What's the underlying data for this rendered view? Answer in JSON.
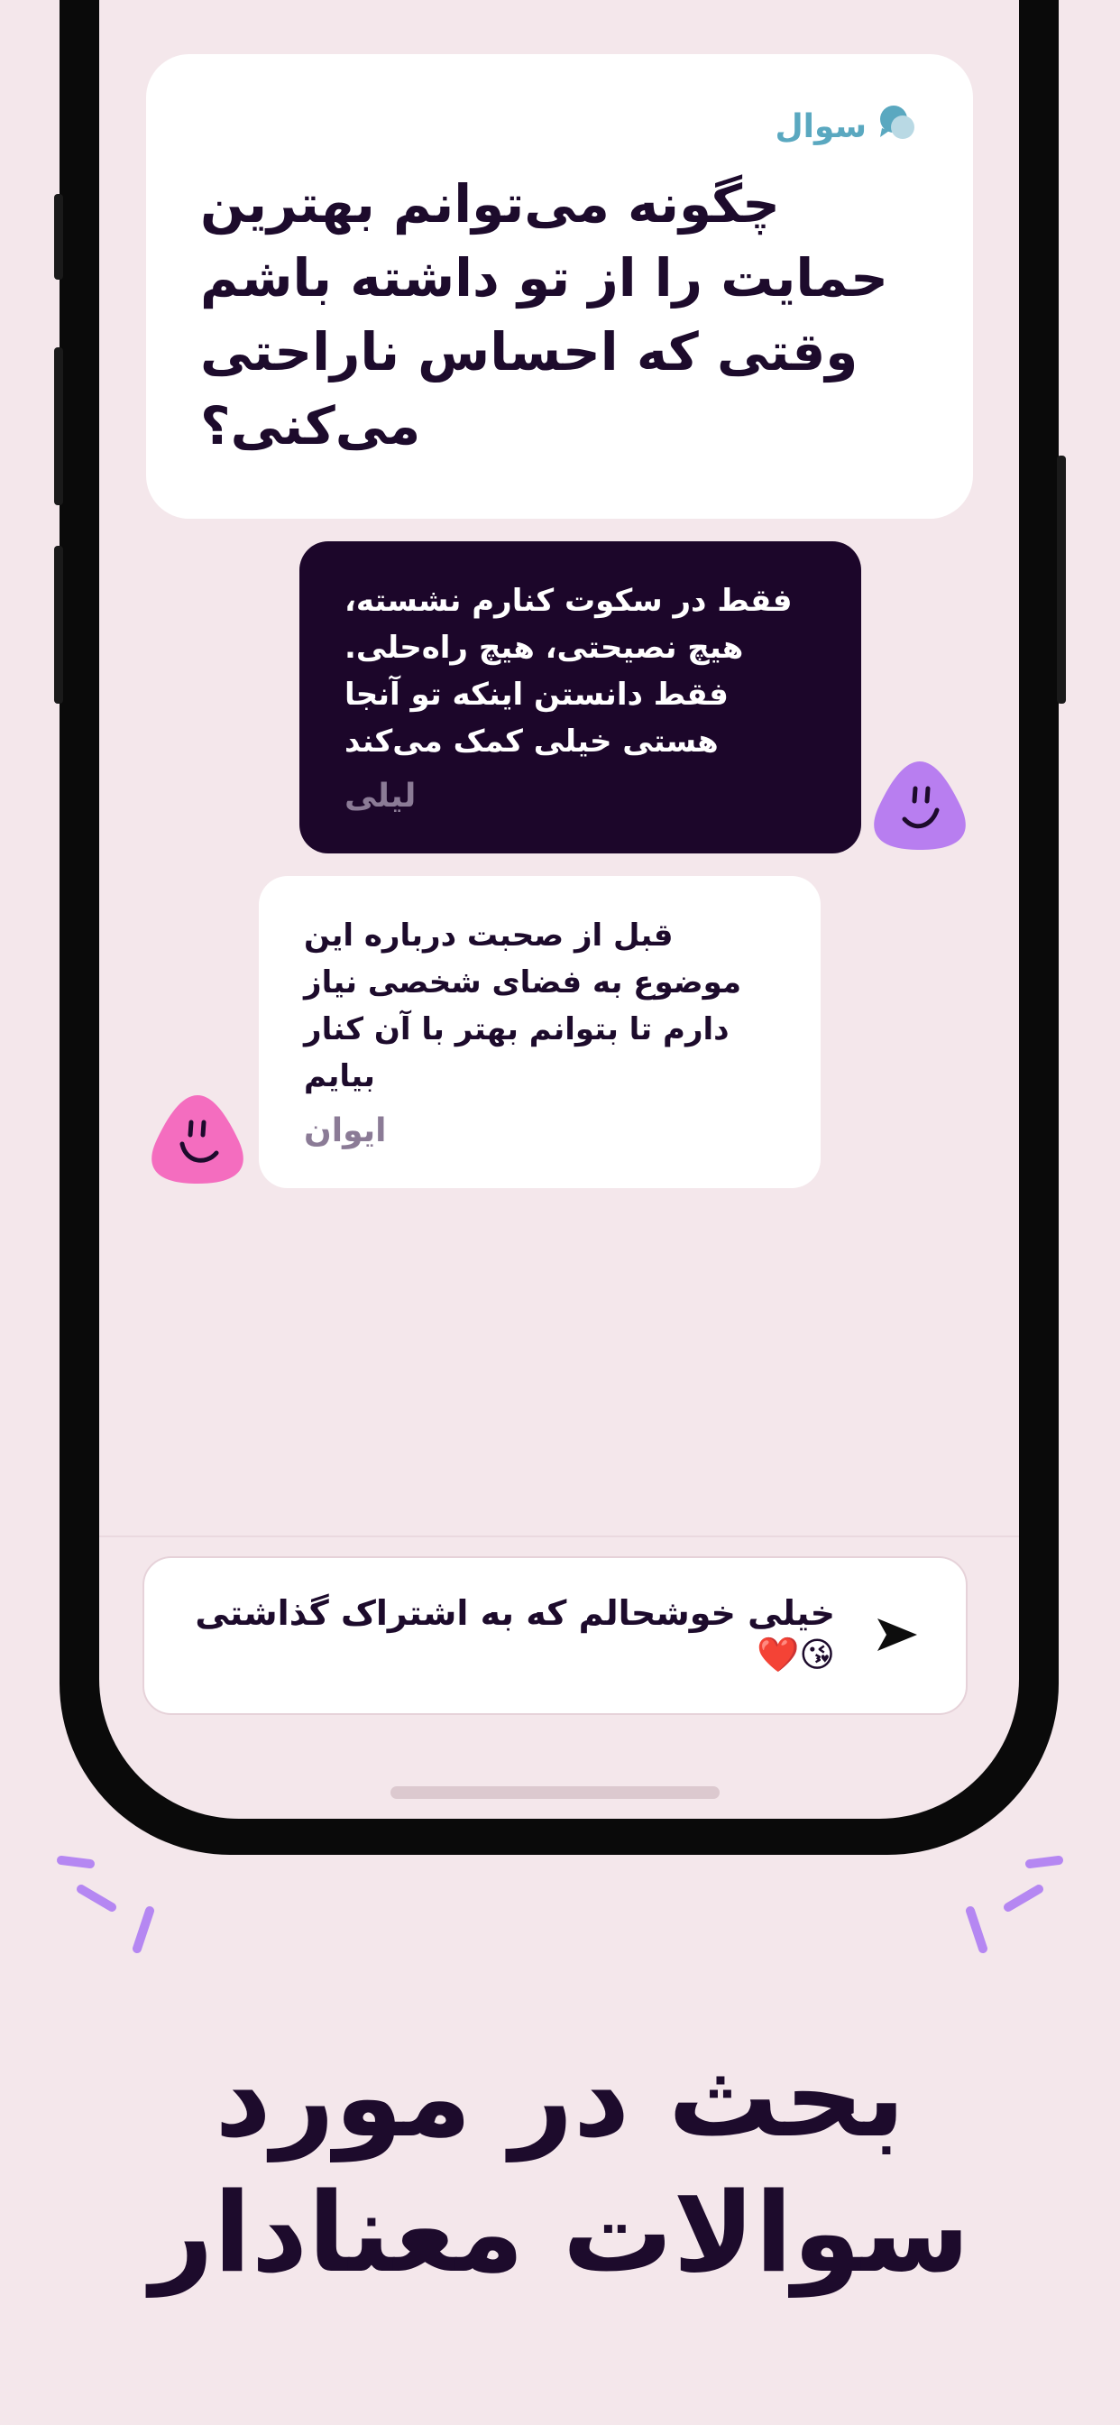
{
  "question_card": {
    "label": "سوال",
    "text": "چگونه می‌توانم بهترین حمایت را از تو داشته باشم وقتی که احساس ناراحتی می‌کنی؟"
  },
  "messages": [
    {
      "text": "فقط در سکوت کنارم نشسته، هیچ نصیحتی، هیچ راه‌حلی. فقط دانستن اینکه تو آنجا هستی خیلی کمک می‌کند",
      "author": "لیلی",
      "avatar_color": "#b87ef0"
    },
    {
      "text": "قبل از صحبت درباره این موضوع به فضای شخصی نیاز دارم تا بتوانم بهتر با آن کنار بیایم",
      "author": "ایوان",
      "avatar_color": "#f46dbf"
    }
  ],
  "composer": {
    "value": "خیلی خوشحالم که به اشتراک گذاشتی 😘❤️",
    "send_icon": "send-icon"
  },
  "headline": {
    "line1": "بحث در مورد",
    "line2": "سوالات معنادار"
  },
  "colors": {
    "background": "#f4e7eb",
    "dark_text": "#1d0b2c",
    "question_label": "#5aa8c0",
    "sparkle": "#b587f2"
  }
}
